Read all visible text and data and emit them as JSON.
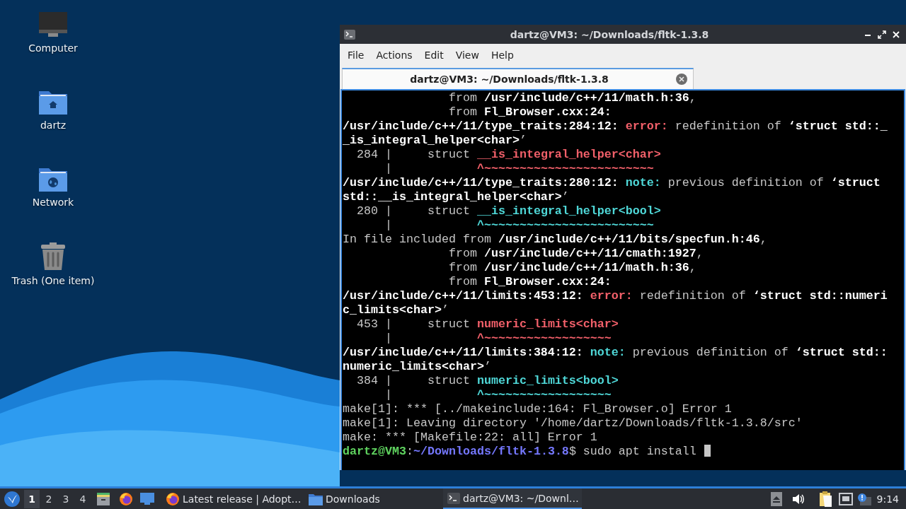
{
  "desktop_icons": [
    {
      "kind": "computer",
      "label": "Computer"
    },
    {
      "kind": "home",
      "label": "dartz"
    },
    {
      "kind": "network",
      "label": "Network"
    },
    {
      "kind": "trash",
      "label": "Trash (One item)"
    }
  ],
  "window": {
    "title": "dartz@VM3: ~/Downloads/fltk-1.3.8",
    "menu": [
      "File",
      "Actions",
      "Edit",
      "View",
      "Help"
    ],
    "tabs": [
      {
        "label": "dartz@VM3: ~/Downloads/fltk-1.3.8",
        "selected": true
      }
    ],
    "terminal_lines": [
      [
        {
          "kind": "plain",
          "text": "               from "
        },
        {
          "kind": "bold",
          "text": "/usr/include/c++/11/math.h:36"
        },
        {
          "kind": "plain",
          "text": ","
        }
      ],
      [
        {
          "kind": "plain",
          "text": "               from "
        },
        {
          "kind": "bold",
          "text": "Fl_Browser.cxx:24:"
        }
      ],
      [
        {
          "kind": "bold",
          "text": "/usr/include/c++/11/type_traits:284:12: "
        },
        {
          "kind": "error",
          "text": "error:"
        },
        {
          "kind": "plain",
          "text": " redefinition of "
        },
        {
          "kind": "bold",
          "text": "‘struct std::_"
        }
      ],
      [
        {
          "kind": "bold",
          "text": "_is_integral_helper<char>"
        },
        {
          "kind": "plain",
          "text": "’"
        }
      ],
      [
        {
          "kind": "plain",
          "text": "  284 |     struct "
        },
        {
          "kind": "error",
          "text": "__is_integral_helper<char>"
        }
      ],
      [
        {
          "kind": "plain",
          "text": "      |            "
        },
        {
          "kind": "error",
          "text": "^~~~~~~~~~~~~~~~~~~~~~~~~"
        }
      ],
      [
        {
          "kind": "bold",
          "text": "/usr/include/c++/11/type_traits:280:12: "
        },
        {
          "kind": "note",
          "text": "note:"
        },
        {
          "kind": "plain",
          "text": " previous definition of "
        },
        {
          "kind": "bold",
          "text": "‘struct"
        }
      ],
      [
        {
          "kind": "bold",
          "text": "std::__is_integral_helper<char>"
        },
        {
          "kind": "plain",
          "text": "’"
        }
      ],
      [
        {
          "kind": "plain",
          "text": "  280 |     struct "
        },
        {
          "kind": "note",
          "text": "__is_integral_helper<bool>"
        }
      ],
      [
        {
          "kind": "plain",
          "text": "      |            "
        },
        {
          "kind": "note",
          "text": "^~~~~~~~~~~~~~~~~~~~~~~~~"
        }
      ],
      [
        {
          "kind": "plain",
          "text": "In file included from "
        },
        {
          "kind": "bold",
          "text": "/usr/include/c++/11/bits/specfun.h:46"
        },
        {
          "kind": "plain",
          "text": ","
        }
      ],
      [
        {
          "kind": "plain",
          "text": "               from "
        },
        {
          "kind": "bold",
          "text": "/usr/include/c++/11/cmath:1927"
        },
        {
          "kind": "plain",
          "text": ","
        }
      ],
      [
        {
          "kind": "plain",
          "text": "               from "
        },
        {
          "kind": "bold",
          "text": "/usr/include/c++/11/math.h:36"
        },
        {
          "kind": "plain",
          "text": ","
        }
      ],
      [
        {
          "kind": "plain",
          "text": "               from "
        },
        {
          "kind": "bold",
          "text": "Fl_Browser.cxx:24:"
        }
      ],
      [
        {
          "kind": "bold",
          "text": "/usr/include/c++/11/limits:453:12: "
        },
        {
          "kind": "error",
          "text": "error:"
        },
        {
          "kind": "plain",
          "text": " redefinition of "
        },
        {
          "kind": "bold",
          "text": "‘struct std::numeri"
        }
      ],
      [
        {
          "kind": "bold",
          "text": "c_limits<char>"
        },
        {
          "kind": "plain",
          "text": "’"
        }
      ],
      [
        {
          "kind": "plain",
          "text": "  453 |     struct "
        },
        {
          "kind": "error",
          "text": "numeric_limits<char>"
        }
      ],
      [
        {
          "kind": "plain",
          "text": "      |            "
        },
        {
          "kind": "error",
          "text": "^~~~~~~~~~~~~~~~~~~"
        }
      ],
      [
        {
          "kind": "bold",
          "text": "/usr/include/c++/11/limits:384:12: "
        },
        {
          "kind": "note",
          "text": "note:"
        },
        {
          "kind": "plain",
          "text": " previous definition of "
        },
        {
          "kind": "bold",
          "text": "‘struct std::"
        }
      ],
      [
        {
          "kind": "bold",
          "text": "numeric_limits<char>"
        },
        {
          "kind": "plain",
          "text": "’"
        }
      ],
      [
        {
          "kind": "plain",
          "text": "  384 |     struct "
        },
        {
          "kind": "note",
          "text": "numeric_limits<bool>"
        }
      ],
      [
        {
          "kind": "plain",
          "text": "      |            "
        },
        {
          "kind": "note",
          "text": "^~~~~~~~~~~~~~~~~~~"
        }
      ],
      [
        {
          "kind": "plain",
          "text": "make[1]: *** [../makeinclude:164: Fl_Browser.o] Error 1"
        }
      ],
      [
        {
          "kind": "plain",
          "text": "make[1]: Leaving directory '/home/dartz/Downloads/fltk-1.3.8/src'"
        }
      ],
      [
        {
          "kind": "plain",
          "text": "make: *** [Makefile:22: all] Error 1"
        }
      ],
      [
        {
          "kind": "user",
          "text": "dartz@VM3"
        },
        {
          "kind": "plain",
          "text": ":"
        },
        {
          "kind": "path",
          "text": "~/Downloads/fltk-1.3.8"
        },
        {
          "kind": "plain",
          "text": "$ sudo apt install "
        }
      ]
    ]
  },
  "taskbar": {
    "workspaces": [
      {
        "label": "1",
        "selected": true
      },
      {
        "label": "2",
        "selected": false
      },
      {
        "label": "3",
        "selected": false
      },
      {
        "label": "4",
        "selected": false
      }
    ],
    "tasks": [
      {
        "kind": "browser",
        "label": "Latest release | Adopt…",
        "selected": false
      },
      {
        "kind": "folder",
        "label": "Downloads",
        "selected": false
      },
      {
        "kind": "terminal",
        "label": "dartz@VM3: ~/Downl…",
        "selected": true
      }
    ],
    "clock": "9:14"
  }
}
